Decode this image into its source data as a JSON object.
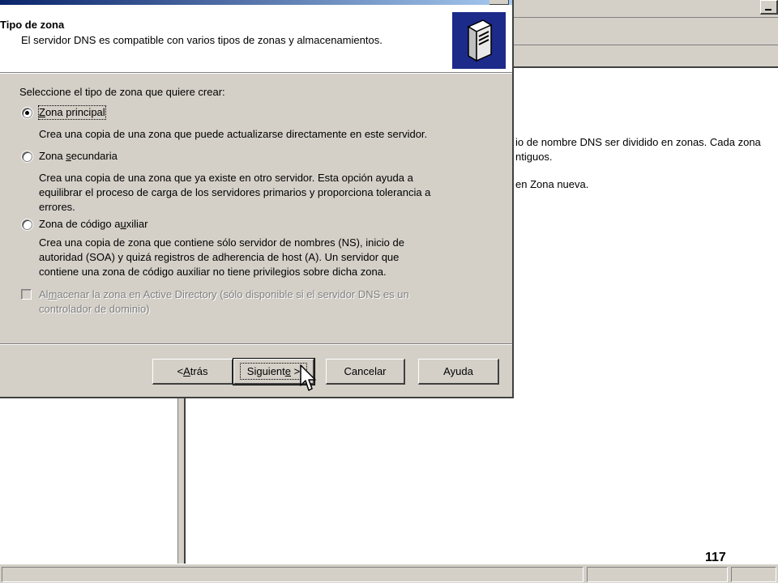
{
  "background": {
    "info_lines": [
      "io de nombre DNS ser dividido en zonas. Cada zona",
      "ntiguos.",
      "en Zona nueva."
    ],
    "page_number": "117"
  },
  "wizard": {
    "header": {
      "title": "Tipo de zona",
      "subtitle": "El servidor DNS es compatible con varios tipos de zonas y almacenamientos.",
      "icon": "dns-server-icon"
    },
    "prompt": "Seleccione el tipo de zona que quiere crear:",
    "options": [
      {
        "label_before": "",
        "mnemonic": "Z",
        "label_after": "ona principal",
        "selected": true,
        "description": [
          "Crea una copia de una zona que puede actualizarse directamente en este servidor."
        ]
      },
      {
        "label_before": "Zona ",
        "mnemonic": "s",
        "label_after": "ecundaria",
        "selected": false,
        "description": [
          "Crea una copia de una zona que ya existe en otro servidor. Esta opción ayuda a",
          "equilibrar el proceso de carga de los servidores primarios y proporciona tolerancia a",
          "errores."
        ]
      },
      {
        "label_before": "Zona de código a",
        "mnemonic": "u",
        "label_after": "xiliar",
        "selected": false,
        "description": [
          "Crea una copia de zona que contiene sólo servidor de nombres (NS), inicio de",
          "autoridad (SOA) y quizá registros de adherencia de host (A). Un servidor que",
          "contiene una zona de código auxiliar no tiene privilegios sobre dicha zona."
        ]
      }
    ],
    "store_ad": {
      "line1_before": "Al",
      "line1_mnemonic": "m",
      "line1_after": "acenar la zona en Active Directory (sólo disponible si el servidor DNS es un",
      "line2": "controlador de dominio)",
      "checked": false,
      "enabled": false
    },
    "buttons": {
      "back_prefix": "< ",
      "back_mnemonic": "A",
      "back_rest": "trás",
      "next_before": "Siguient",
      "next_mnemonic": "e",
      "next_after": " >",
      "cancel": "Cancelar",
      "help": "Ayuda"
    }
  }
}
